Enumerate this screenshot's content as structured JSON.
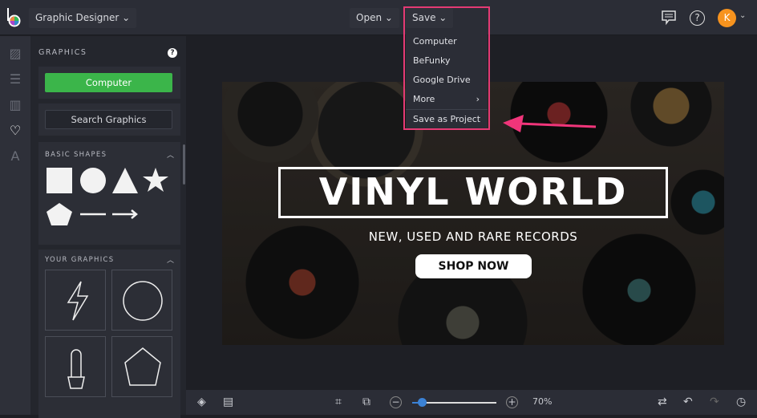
{
  "header": {
    "app_menu": "Graphic Designer",
    "open": "Open",
    "save": "Save",
    "avatar_initial": "K"
  },
  "save_menu": {
    "items": [
      "Computer",
      "BeFunky",
      "Google Drive",
      "More",
      "Save as Project"
    ]
  },
  "panel": {
    "title": "GRAPHICS",
    "computer": "Computer",
    "search": "Search Graphics",
    "basic_shapes": "BASIC SHAPES",
    "your_graphics": "YOUR GRAPHICS"
  },
  "canvas": {
    "headline": "VINYL WORLD",
    "subheadline": "NEW, USED AND RARE RECORDS",
    "cta": "SHOP NOW"
  },
  "bottom": {
    "zoom": "70%",
    "zoom_value": 70
  },
  "colors": {
    "accent_green": "#3bb54a",
    "highlight": "#e43a74",
    "avatar": "#f7931e",
    "slider": "#3b82d6"
  }
}
